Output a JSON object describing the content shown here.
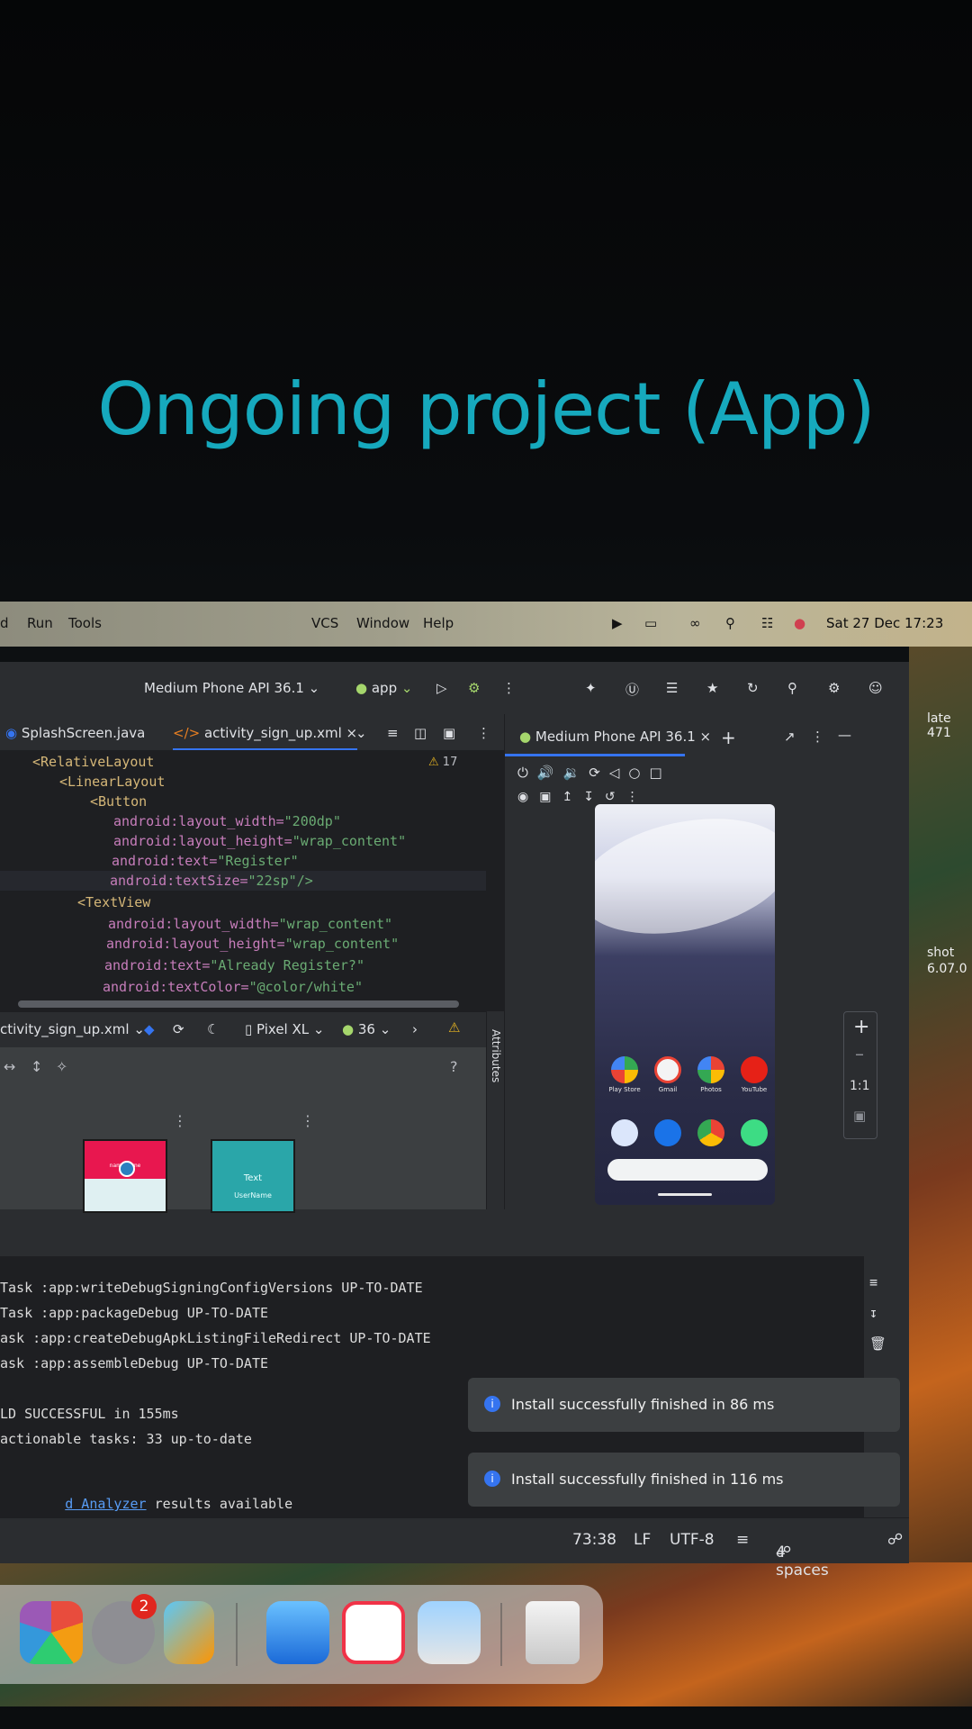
{
  "caption": "Ongoing project (App)",
  "menubar": {
    "items": [
      "d",
      "Run",
      "Tools",
      "VCS",
      "Window",
      "Help"
    ],
    "clock": "Sat 27 Dec 17:23"
  },
  "desktop": {
    "right_labels": [
      "late 471",
      "shot",
      "6.07.0"
    ]
  },
  "ide": {
    "device_selector": "Medium Phone API 36.1",
    "run_config": "app",
    "tabs": [
      "SplashScreen.java",
      "activity_sign_up.xml"
    ],
    "warnings_count": "17",
    "code_lines": [
      {
        "tag": "<RelativeLayout"
      },
      {
        "tag": "<LinearLayout"
      },
      {
        "tag": "<Button"
      },
      {
        "attr": "android:layout_width=",
        "val": "\"200dp\""
      },
      {
        "attr": "android:layout_height=",
        "val": "\"wrap_content\""
      },
      {
        "attr": "android:text=",
        "val": "\"Register\""
      },
      {
        "attr": "android:textSize=",
        "val": "\"22sp\"/>"
      },
      {
        "tag": "<TextView"
      },
      {
        "attr": "android:layout_width=",
        "val": "\"wrap_content\""
      },
      {
        "attr": "android:layout_height=",
        "val": "\"wrap_content\""
      },
      {
        "attr": "android:text=",
        "val": "\"Already Register?\""
      },
      {
        "attr": "android:textColor=",
        "val": "\"@color/white\""
      }
    ],
    "design_bar": {
      "file": "ctivity_sign_up.xml",
      "device": "Pixel XL",
      "api": "36"
    },
    "attributes_label": "Attributes",
    "design_previews": [
      "nameName",
      "Text",
      "UserName"
    ],
    "emulator": {
      "tab": "Medium Phone API 36.1",
      "apps_row1": [
        "Play Store",
        "Gmail",
        "Photos",
        "YouTube"
      ],
      "zoom_label": "1:1"
    },
    "build_output": [
      "Task :app:writeDebugSigningConfigVersions UP-TO-DATE",
      "Task :app:packageDebug UP-TO-DATE",
      "ask :app:createDebugApkListingFileRedirect UP-TO-DATE",
      "ask :app:assembleDebug UP-TO-DATE",
      "LD SUCCESSFUL in 155ms",
      "actionable tasks: 33 up-to-date"
    ],
    "build_link": "d Analyzer",
    "build_link_suffix": " results available",
    "toasts": [
      "Install successfully finished in 86 ms",
      "Install successfully finished in 116 ms"
    ],
    "status": {
      "position": "73:38",
      "line_ending": "LF",
      "encoding": "UTF-8",
      "indent": "4 spaces"
    }
  },
  "dock": {
    "settings_badge": "2"
  },
  "colors": {
    "caption": "#16a9bd",
    "ide_bg": "#2b2d30",
    "editor_bg": "#1e1f22",
    "accent": "#3574f0"
  }
}
